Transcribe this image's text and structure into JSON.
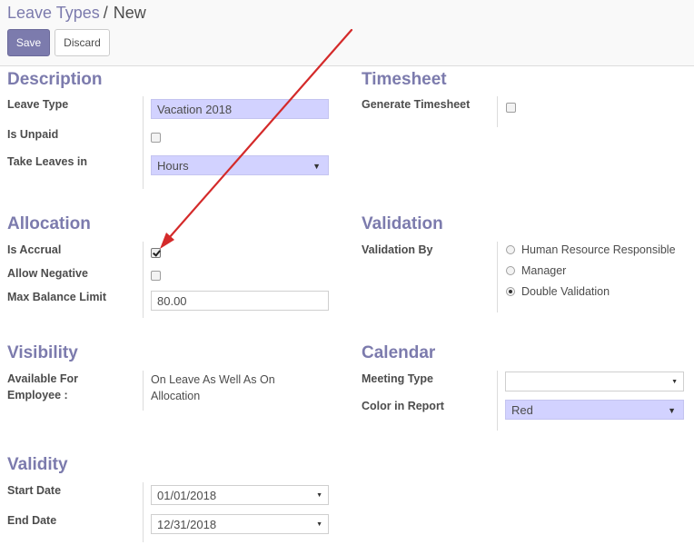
{
  "breadcrumb": {
    "parent": "Leave Types",
    "separator": "/",
    "current": "New"
  },
  "buttons": {
    "save": "Save",
    "discard": "Discard"
  },
  "description": {
    "title": "Description",
    "leave_type_label": "Leave Type",
    "leave_type_value": "Vacation 2018",
    "is_unpaid_label": "Is Unpaid",
    "is_unpaid_checked": false,
    "take_leaves_label": "Take Leaves in",
    "take_leaves_value": "Hours"
  },
  "timesheet": {
    "title": "Timesheet",
    "generate_label": "Generate Timesheet",
    "generate_checked": false
  },
  "allocation": {
    "title": "Allocation",
    "is_accrual_label": "Is Accrual",
    "is_accrual_checked": true,
    "allow_negative_label": "Allow Negative",
    "allow_negative_checked": false,
    "max_balance_label": "Max Balance Limit",
    "max_balance_value": "80.00"
  },
  "validation": {
    "title": "Validation",
    "validation_by_label": "Validation By",
    "options": [
      "Human Resource Responsible",
      "Manager",
      "Double Validation"
    ],
    "selected": "Double Validation"
  },
  "visibility": {
    "title": "Visibility",
    "available_label_line1": "Available For",
    "available_label_line2": "Employee :",
    "available_value_line1": "On Leave As Well As On",
    "available_value_line2": "Allocation"
  },
  "calendar": {
    "title": "Calendar",
    "meeting_type_label": "Meeting Type",
    "meeting_type_value": "",
    "color_label": "Color in Report",
    "color_value": "Red"
  },
  "validity": {
    "title": "Validity",
    "start_date_label": "Start Date",
    "start_date_value": "01/01/2018",
    "end_date_label": "End Date",
    "end_date_value": "12/31/2018"
  },
  "colors": {
    "accent": "#7c7bad",
    "required_bg": "#d2d2ff",
    "arrow": "#d42a2a"
  },
  "icons": {
    "dropdown": "caret-down-icon",
    "annotation": "red-arrow"
  }
}
